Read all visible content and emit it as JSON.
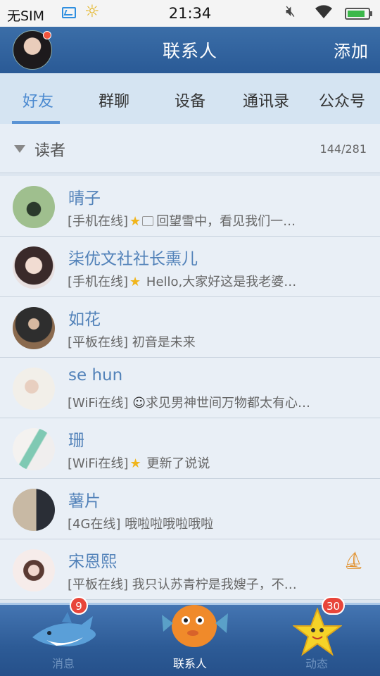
{
  "status_bar": {
    "carrier": "无SIM",
    "time": "21:34",
    "battery_level": 0.85
  },
  "header": {
    "title": "联系人",
    "add_label": "添加"
  },
  "tabs": [
    {
      "label": "好友",
      "active": true
    },
    {
      "label": "群聊",
      "active": false
    },
    {
      "label": "设备",
      "active": false
    },
    {
      "label": "通讯录",
      "active": false
    },
    {
      "label": "公众号",
      "active": false
    }
  ],
  "group": {
    "name": "读者",
    "count": "144/281"
  },
  "contacts": [
    {
      "name": "晴子",
      "status": "[手机在线]",
      "message": "回望雪中，看见我们一…",
      "icons": [
        "star-icon",
        "picture-icon"
      ]
    },
    {
      "name": "柒优文社社长熏儿",
      "status": "[手机在线]",
      "message": "Hello,大家好这是我老婆…",
      "icons": [
        "star-icon"
      ]
    },
    {
      "name": "如花",
      "status": "[平板在线]",
      "message": "初音是未来",
      "icons": []
    },
    {
      "name": "se hun",
      "status": "[WiFi在线]",
      "message": "求见男神世间万物都太有心…",
      "icons": [
        "smile-icon"
      ]
    },
    {
      "name": "珊",
      "status": "[WiFi在线]",
      "message": "更新了说说",
      "icons": [
        "star-icon"
      ]
    },
    {
      "name": "薯片",
      "status": "[4G在线]",
      "message": "哦啦啦哦啦哦啦",
      "icons": []
    },
    {
      "name": "宋恩熙",
      "status": "[平板在线]",
      "message": "我只认苏青柠是我嫂子，不…",
      "icons": [
        "boat-icon"
      ]
    }
  ],
  "bottom_nav": [
    {
      "label": "消息",
      "badge": "9",
      "active": false
    },
    {
      "label": "联系人",
      "badge": "",
      "active": true
    },
    {
      "label": "动态",
      "badge": "30",
      "active": false
    }
  ],
  "colors": {
    "header_blue": "#2a5a96",
    "tab_active": "#4c8ad0",
    "name_blue": "#5282b9",
    "badge_red": "#e8453a",
    "star_gold": "#f0b51c"
  }
}
